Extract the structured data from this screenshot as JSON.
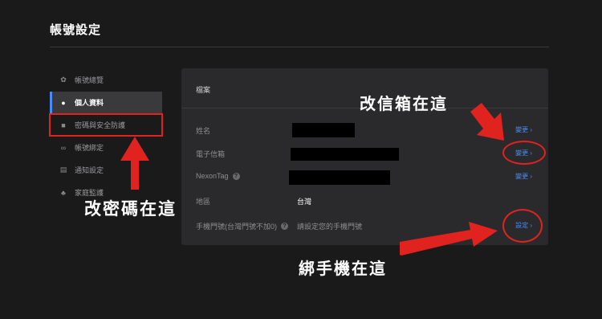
{
  "page": {
    "title": "帳號設定"
  },
  "sidebar": {
    "items": [
      {
        "label": "帳號總覽",
        "icon": "gear-icon",
        "glyph": "✿"
      },
      {
        "label": "個人資料",
        "icon": "user-icon",
        "glyph": "👤"
      },
      {
        "label": "密碼與安全防護",
        "icon": "lock-icon",
        "glyph": "🔒"
      },
      {
        "label": "帳號綁定",
        "icon": "link-icon",
        "glyph": "🔗"
      },
      {
        "label": "通知設定",
        "icon": "message-icon",
        "glyph": "✉"
      },
      {
        "label": "家庭監護",
        "icon": "family-icon",
        "glyph": "👪"
      }
    ],
    "active_index": 1
  },
  "panel": {
    "header": "檔案",
    "rows": [
      {
        "label": "姓名",
        "value": "",
        "action": "變更 ›"
      },
      {
        "label": "電子信箱",
        "value": "",
        "action": "變更 ›"
      },
      {
        "label": "NexonTag",
        "value": "",
        "action": "變更 ›",
        "help": "?"
      },
      {
        "label": "地區",
        "value": "台灣",
        "action": ""
      },
      {
        "label": "手機門號(台灣門號不加0)",
        "value": "請設定您的手機門號",
        "action": "設定 ›",
        "help": "?"
      }
    ]
  },
  "annotations": {
    "email_callout": "改信箱在這",
    "password_callout": "改密碼在這",
    "phone_callout": "綁手機在這",
    "accent_color": "#e0231f"
  }
}
